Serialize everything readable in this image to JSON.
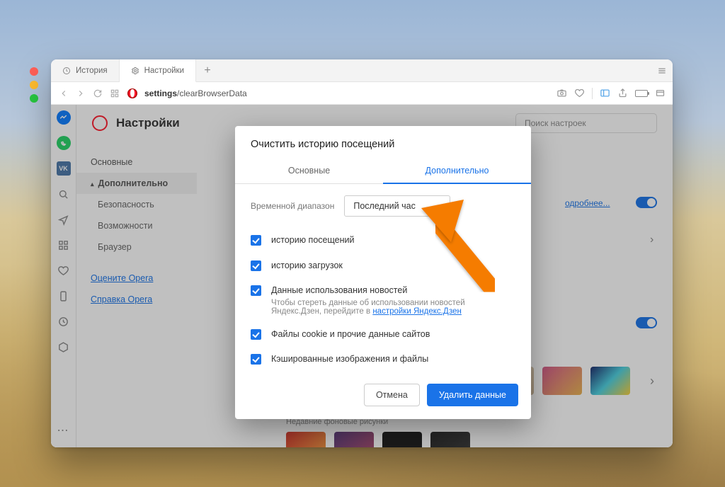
{
  "tabs": {
    "history": "История",
    "settings": "Настройки"
  },
  "address": {
    "domain": "settings",
    "path": "/clearBrowserData"
  },
  "page": {
    "title": "Настройки",
    "search_placeholder": "Поиск настроек",
    "nav": {
      "basic": "Основные",
      "advanced": "Дополнительно",
      "security": "Безопасность",
      "features": "Возможности",
      "browser": "Браузер",
      "rate": "Оцените Opera",
      "help": "Справка Opera"
    },
    "more": "одробнее...",
    "recent_wallpapers": "Недавние фоновые рисунки"
  },
  "modal": {
    "title": "Очистить историю посещений",
    "tab_basic": "Основные",
    "tab_advanced": "Дополнительно",
    "range_label": "Временной диапазон",
    "range_value": "Последний час",
    "items": {
      "history": "историю посещений",
      "downloads": "историю загрузок",
      "news_title": "Данные использования новостей",
      "news_sub": "Чтобы стереть данные об использовании новостей Яндекс.Дзен, перейдите в ",
      "news_link": "настройки Яндекс.Дзен",
      "cookies": "Файлы cookie и прочие данные сайтов",
      "cache": "Кэшированные изображения и файлы"
    },
    "cancel": "Отмена",
    "confirm": "Удалить данные"
  }
}
